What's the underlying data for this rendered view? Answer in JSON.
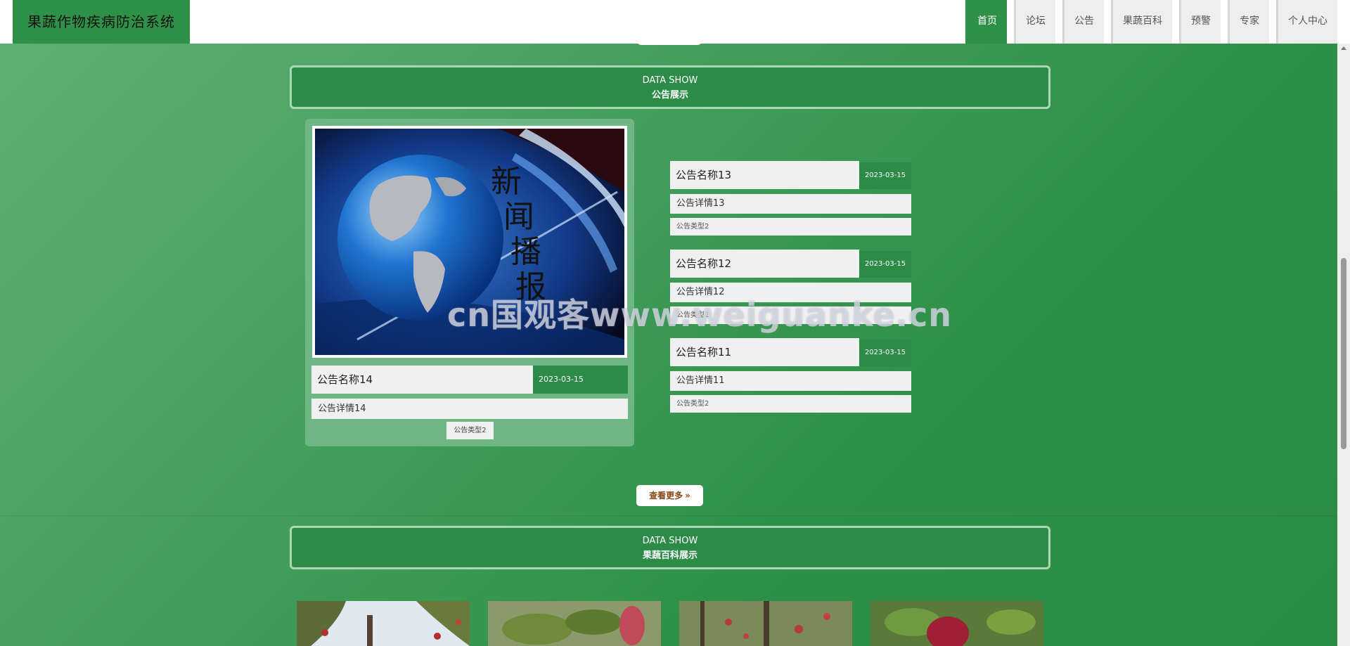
{
  "header": {
    "site_title": "果蔬作物疾病防治系统",
    "nav": [
      {
        "label": "首页",
        "active": true
      },
      {
        "label": "论坛",
        "active": false
      },
      {
        "label": "公告",
        "active": false
      },
      {
        "label": "果蔬百科",
        "active": false
      },
      {
        "label": "预警",
        "active": false
      },
      {
        "label": "专家",
        "active": false
      },
      {
        "label": "个人中心",
        "active": false
      }
    ]
  },
  "notice_section": {
    "title_en": "DATA SHOW",
    "title_cn": "公告展示",
    "featured": {
      "title": "公告名称14",
      "date": "2023-03-15",
      "detail": "公告详情14",
      "type": "公告类型2",
      "image_text": "新闻播报"
    },
    "items": [
      {
        "title": "公告名称13",
        "date": "2023-03-15",
        "detail": "公告详情13",
        "type": "公告类型2"
      },
      {
        "title": "公告名称12",
        "date": "2023-03-15",
        "detail": "公告详情12",
        "type": "公告类型2"
      },
      {
        "title": "公告名称11",
        "date": "2023-03-15",
        "detail": "公告详情11",
        "type": "公告类型2"
      }
    ],
    "more_label": "查看更多"
  },
  "encyclopedia_section": {
    "title_en": "DATA SHOW",
    "title_cn": "果蔬百科展示"
  },
  "watermark": "cn国观客www.weiguanke.cn",
  "colors": {
    "primary": "#2c8c47",
    "background": "#4aa262",
    "card_bg": "#f0f0f0",
    "more_text": "#8b4513"
  }
}
